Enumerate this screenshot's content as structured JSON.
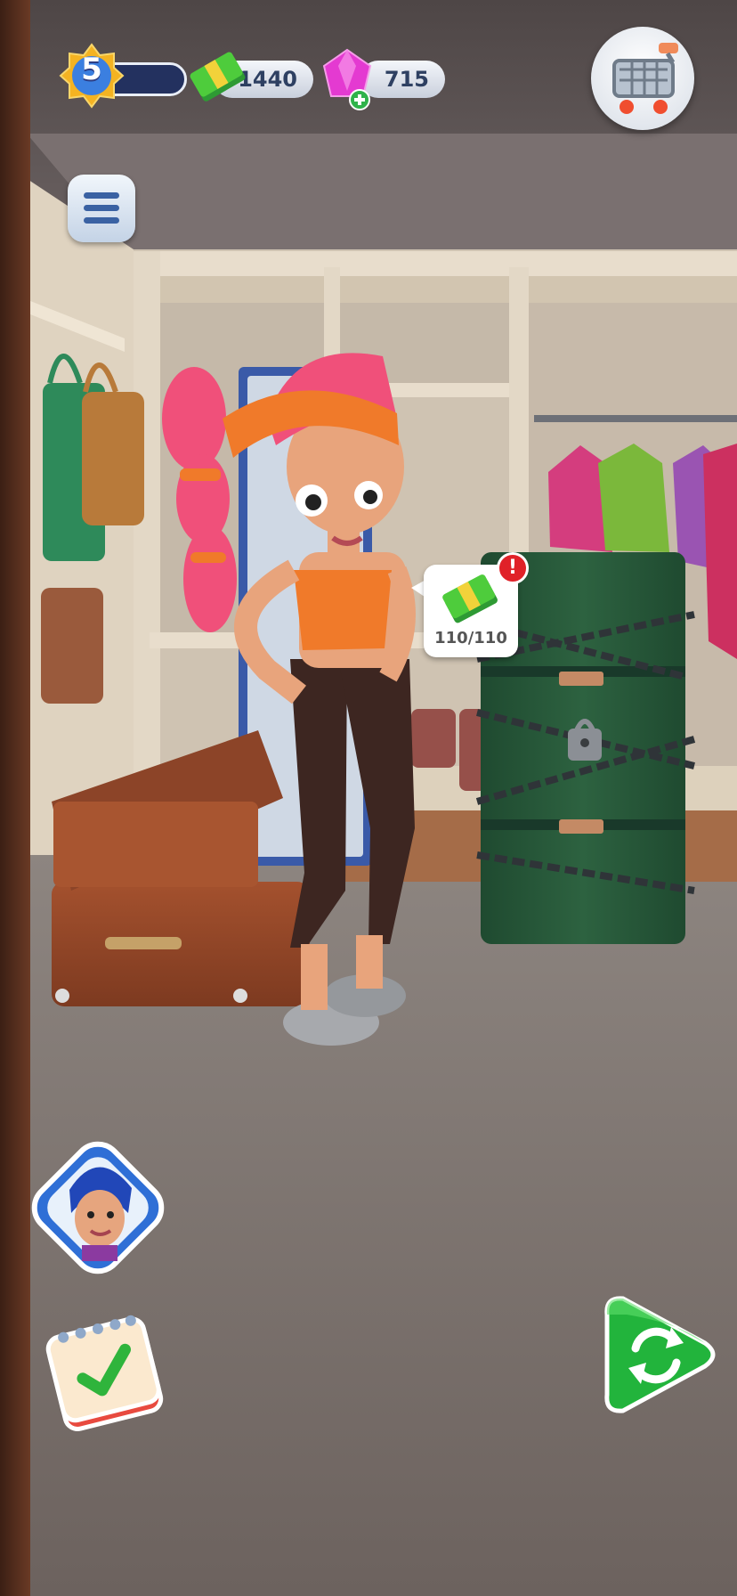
{
  "hud": {
    "level": "5",
    "cash": "1440",
    "gems": "715"
  },
  "chest_tooltip": {
    "progress": "110/110",
    "alert_mark": "!"
  },
  "icons": {
    "level": "star-badge-icon",
    "cash": "cash-stack-icon",
    "gems": "pink-gem-icon",
    "add_gems": "plus-icon",
    "shop": "shopping-cart-icon",
    "menu": "hamburger-menu-icon",
    "character": "character-portrait-icon",
    "tasks": "checklist-notepad-icon",
    "swap": "swap-arrows-icon"
  },
  "colors": {
    "accent_blue": "#2f6fd6",
    "cash_green": "#3fbf3a",
    "gem_pink": "#e43ad1",
    "alert_red": "#e02128",
    "swap_green": "#22b43c"
  }
}
